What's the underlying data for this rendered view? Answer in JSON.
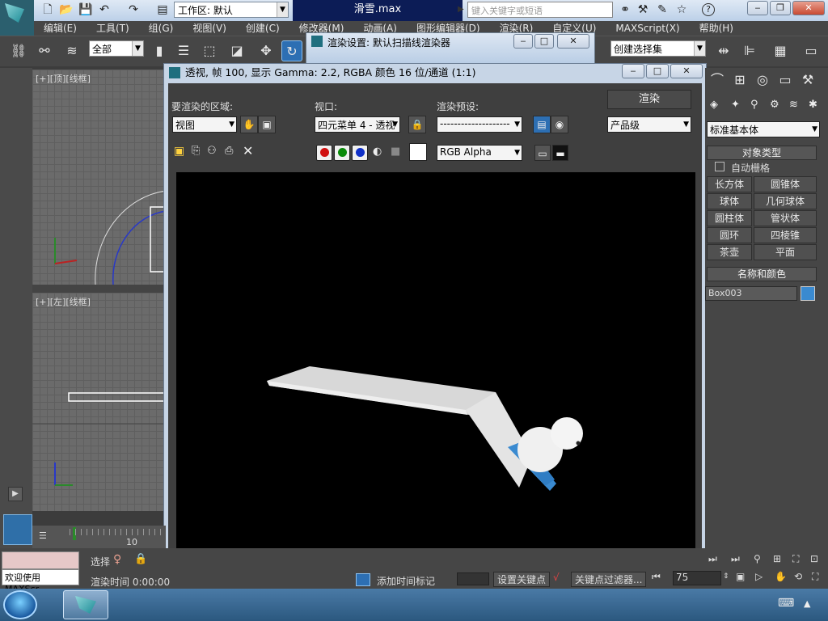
{
  "app": {
    "workspace_label": "工作区: 默认",
    "filename": "滑雪.max",
    "search_placeholder": "键入关键字或短语"
  },
  "menu": [
    "编辑(E)",
    "工具(T)",
    "组(G)",
    "视图(V)",
    "创建(C)",
    "修改器(M)",
    "动画(A)",
    "图形编辑器(D)",
    "渲染(R)",
    "自定义(U)",
    "MAXScript(X)",
    "帮助(H)"
  ],
  "toolbar": {
    "selection_filter": "全部",
    "named_selection_set": "创建选择集"
  },
  "viewports": {
    "top": "[+][顶][线框]",
    "left": "[+][左][线框]"
  },
  "render_setup": {
    "title": "渲染设置: 默认扫描线渲染器"
  },
  "frame_window": {
    "title": "透视, 帧 100, 显示 Gamma: 2.2, RGBA 颜色 16 位/通道 (1:1)",
    "area_label": "要渲染的区域:",
    "area_value": "视图",
    "viewport_label": "视口:",
    "viewport_value": "四元菜单 4 - 透视",
    "preset_label": "渲染预设:",
    "preset_value": "--------------------",
    "render_button": "渲染",
    "quality_value": "产品级",
    "channel_value": "RGB Alpha"
  },
  "command_panel": {
    "category": "标准基本体",
    "object_type_header": "对象类型",
    "autogrid": "自动栅格",
    "objects": [
      "长方体",
      "圆锥体",
      "球体",
      "几何球体",
      "圆柱体",
      "管状体",
      "圆环",
      "四棱锥",
      "茶壶",
      "平面"
    ],
    "name_color_header": "名称和颜色",
    "object_name": "Box003",
    "object_color": "#3a8ad0"
  },
  "status": {
    "maxscript": "欢迎使用 MAXScr",
    "render_time": "渲染时间  0:00:00",
    "add_time_tag": "添加时间标记",
    "set_key": "设置关键点",
    "key_filters": "关键点过滤器...",
    "select_label": "选择",
    "frame_value": "75",
    "timeline_tick": "10"
  }
}
